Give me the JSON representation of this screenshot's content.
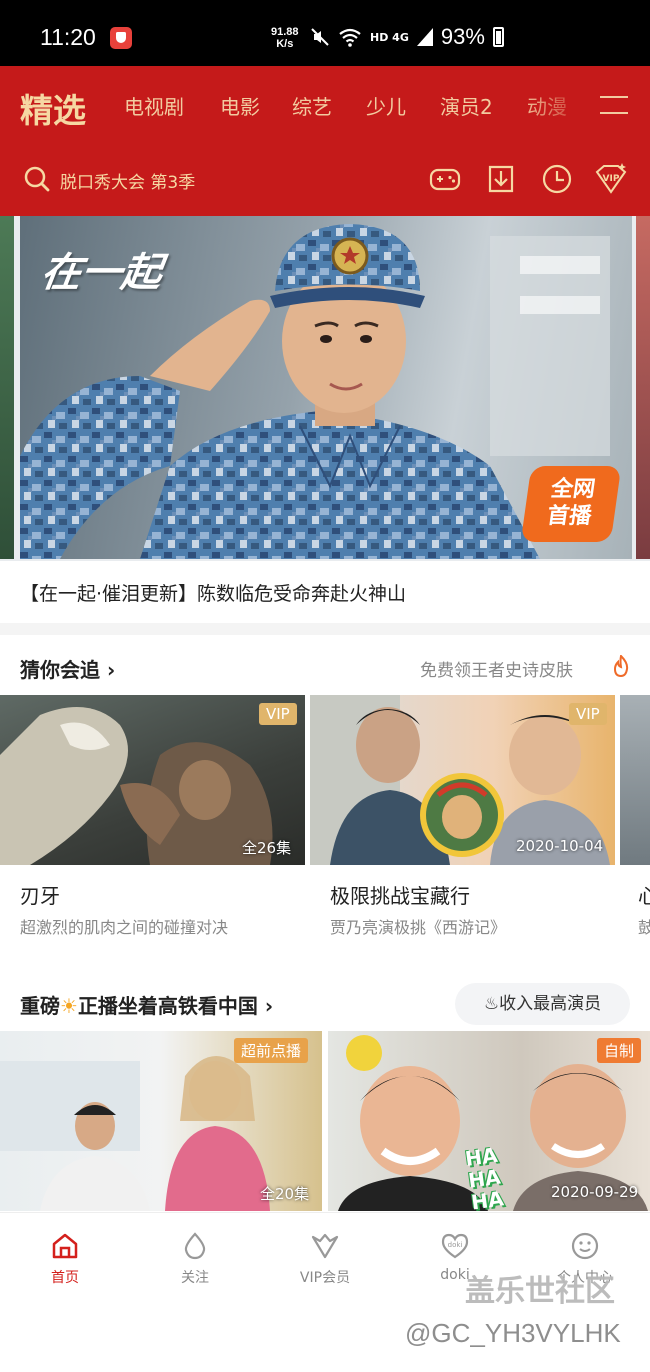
{
  "status_bar": {
    "time": "11:20",
    "net_speed_value": "91.88",
    "net_speed_unit": "K/s",
    "network": "HD 4G",
    "battery": "93%"
  },
  "nav": {
    "active": "精选",
    "items": [
      "电视剧",
      "电影",
      "综艺",
      "少儿",
      "演员2",
      "动漫"
    ]
  },
  "search": {
    "placeholder": "脱口秀大会 第3季"
  },
  "banner": {
    "title_art": "在一起",
    "live_badge_line1": "全网",
    "live_badge_line2": "首播",
    "caption": "【在一起·催泪更新】陈数临危受命奔赴火神山"
  },
  "section1": {
    "title": "猜你会追",
    "promo": "免费领王者史诗皮肤",
    "cards": [
      {
        "badge": "VIP",
        "meta": "全26集",
        "title": "刃牙",
        "subtitle": "超激烈的肌肉之间的碰撞对决"
      },
      {
        "badge": "VIP",
        "meta": "2020-10-04",
        "title": "极限挑战宝藏行",
        "subtitle": "贾乃亮演极挑《西游记》"
      },
      {
        "title": "心",
        "subtitle": "鼓"
      }
    ]
  },
  "section2": {
    "title_a": "重磅",
    "title_b": "正播坐着高铁看中国",
    "pill": "♨收入最高演员",
    "cards": [
      {
        "badge": "超前点播",
        "meta": "全20集"
      },
      {
        "badge": "自制",
        "meta": "2020-09-29",
        "sticker": "HA HA HA"
      }
    ]
  },
  "tabbar": {
    "items": [
      {
        "label": "首页",
        "icon": "home-icon",
        "active": true
      },
      {
        "label": "关注",
        "icon": "drop-icon"
      },
      {
        "label": "VIP会员",
        "icon": "vip-crown-icon"
      },
      {
        "label": "doki",
        "icon": "doki-heart-icon"
      },
      {
        "label": "个人中心",
        "icon": "profile-smile-icon"
      }
    ]
  },
  "watermark": {
    "line1": "盖乐世社区",
    "line2": "@GC_YH3VYLHK"
  },
  "colors": {
    "header_red": "#c51a1a",
    "header_gold": "#f6d8a3",
    "active_tab": "#d4201c",
    "vip_gold": "#e0b56b"
  }
}
